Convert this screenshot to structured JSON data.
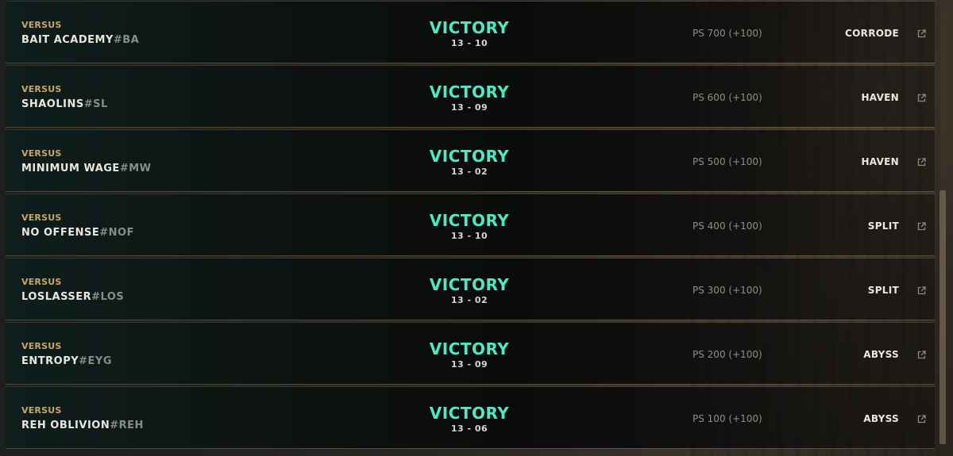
{
  "matches": [
    {
      "versus_label": "VERSUS",
      "team": "BAIT ACADEMY",
      "tag": "#BA",
      "result": "VICTORY",
      "score": "13 - 10",
      "ps": "PS 700 (+100)",
      "map": "CORRODE"
    },
    {
      "versus_label": "VERSUS",
      "team": "SHAOLINS",
      "tag": "#SL",
      "result": "VICTORY",
      "score": "13 - 09",
      "ps": "PS 600 (+100)",
      "map": "HAVEN"
    },
    {
      "versus_label": "VERSUS",
      "team": "MINIMUM WAGE",
      "tag": "#MW",
      "result": "VICTORY",
      "score": "13 - 02",
      "ps": "PS 500 (+100)",
      "map": "HAVEN"
    },
    {
      "versus_label": "VERSUS",
      "team": "NO OFFENSE",
      "tag": "#NOF",
      "result": "VICTORY",
      "score": "13 - 10",
      "ps": "PS 400 (+100)",
      "map": "SPLIT"
    },
    {
      "versus_label": "VERSUS",
      "team": "LOSLASSER",
      "tag": "#LOS",
      "result": "VICTORY",
      "score": "13 - 02",
      "ps": "PS 300 (+100)",
      "map": "SPLIT"
    },
    {
      "versus_label": "VERSUS",
      "team": "ENTROPY",
      "tag": "#EYG",
      "result": "VICTORY",
      "score": "13 - 09",
      "ps": "PS 200 (+100)",
      "map": "ABYSS"
    },
    {
      "versus_label": "VERSUS",
      "team": "REH OBLIVION",
      "tag": "#REH",
      "result": "VICTORY",
      "score": "13 - 06",
      "ps": "PS 100 (+100)",
      "map": "ABYSS"
    }
  ],
  "icons": {
    "external_link": "external-link-icon"
  },
  "colors": {
    "victory": "#4fe8c4",
    "versus_label": "#c9a56a",
    "team_name": "#e9e6de",
    "team_tag": "#8a8c86",
    "ps_text": "#8f8e89"
  }
}
